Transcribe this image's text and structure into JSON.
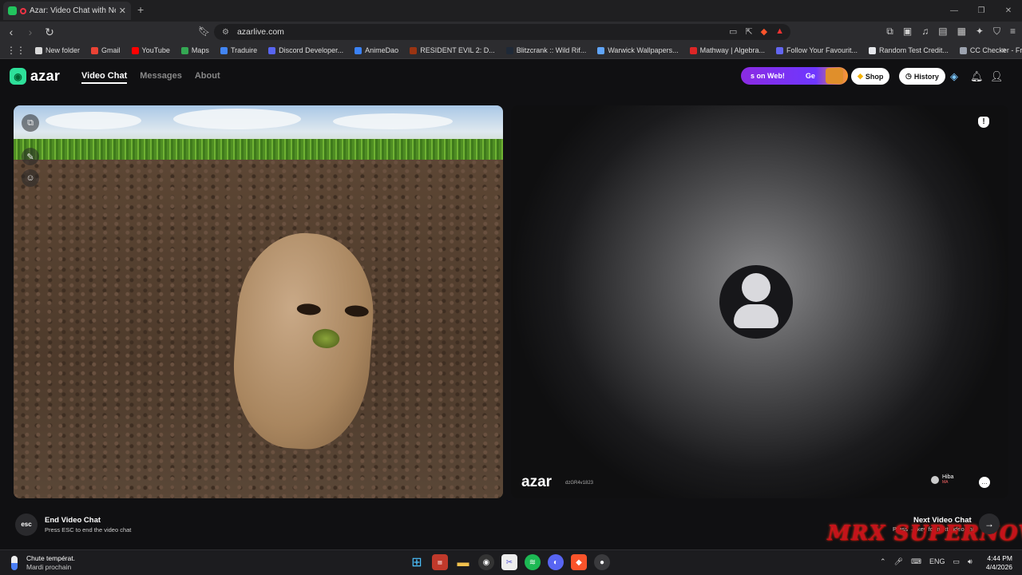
{
  "browser": {
    "tab_title": "Azar: Video Chat with New Pe",
    "tab_close": "✕",
    "new_tab": "+",
    "url": "azarlive.com",
    "bookmarks": [
      {
        "label": "New folder",
        "color": "#d9d9d9"
      },
      {
        "label": "Gmail",
        "color": "#ea4335"
      },
      {
        "label": "YouTube",
        "color": "#ff0000"
      },
      {
        "label": "Maps",
        "color": "#34a853"
      },
      {
        "label": "Traduire",
        "color": "#4285f4"
      },
      {
        "label": "Discord Developer...",
        "color": "#5865f2"
      },
      {
        "label": "AnimeDao",
        "color": "#3b82f6"
      },
      {
        "label": "RESIDENT EVIL 2: D...",
        "color": "#9a3412"
      },
      {
        "label": "Blitzcrank :: Wild Rif...",
        "color": "#1f2937"
      },
      {
        "label": "Warwick Wallpapers...",
        "color": "#60a5fa"
      },
      {
        "label": "Mathway | Algebra...",
        "color": "#dc2626"
      },
      {
        "label": "Follow Your Favourit...",
        "color": "#6366f1"
      },
      {
        "label": "Random Test Credit...",
        "color": "#e5e7eb"
      },
      {
        "label": "CC Checker - Free c...",
        "color": "#9ca3af"
      }
    ]
  },
  "header": {
    "logo_text": "azar",
    "nav": [
      {
        "label": "Video Chat",
        "active": true
      },
      {
        "label": "Messages",
        "active": false
      },
      {
        "label": "About",
        "active": false
      }
    ],
    "promo_text": "s on Web!",
    "promo_tail": "Ge",
    "shop_label": "Shop",
    "history_label": "History"
  },
  "right_video": {
    "logo_text": "azar",
    "id_text": "dzGR4v1823",
    "user_name": "Hiba",
    "user_country": "MA"
  },
  "footer": {
    "esc_label": "esc",
    "end_title": "End Video Chat",
    "end_sub": "Press ESC to end the video chat",
    "next_title": "Next Video Chat",
    "next_sub": "Press → key for next video chat",
    "watermark": "MRX SUPERNOVA"
  },
  "taskbar": {
    "weather_line1": "Chute températ.",
    "weather_line2": "Mardi prochain",
    "lang": "ENG",
    "time": "4:44 PM",
    "date": "4/4/2026"
  }
}
